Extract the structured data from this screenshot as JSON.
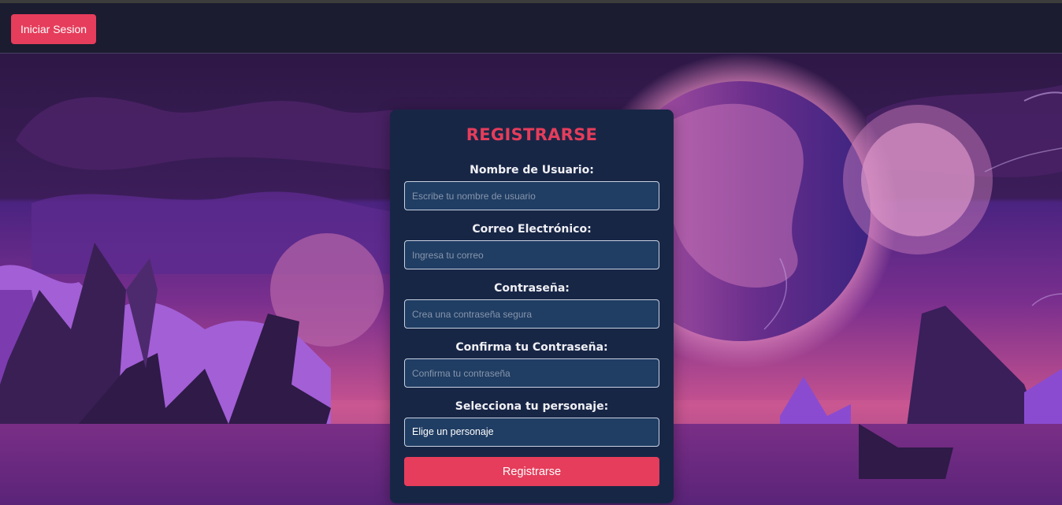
{
  "nav": {
    "login_label": "Iniciar Sesion"
  },
  "form": {
    "title": "REGISTRARSE",
    "username": {
      "label": "Nombre de Usuario:",
      "placeholder": "Escribe tu nombre de usuario"
    },
    "email": {
      "label": "Correo Electrónico:",
      "placeholder": "Ingresa tu correo"
    },
    "password": {
      "label": "Contraseña:",
      "placeholder": "Crea una contraseña segura"
    },
    "confirm": {
      "label": "Confirma tu Contraseña:",
      "placeholder": "Confirma tu contraseña"
    },
    "character": {
      "label": "Selecciona tu personaje:",
      "selected": "Elige un personaje"
    },
    "submit_label": "Registrarse"
  },
  "colors": {
    "accent": "#e53d5b",
    "card": "#182646",
    "input": "#203d63",
    "navbar": "#1b1c2f"
  }
}
